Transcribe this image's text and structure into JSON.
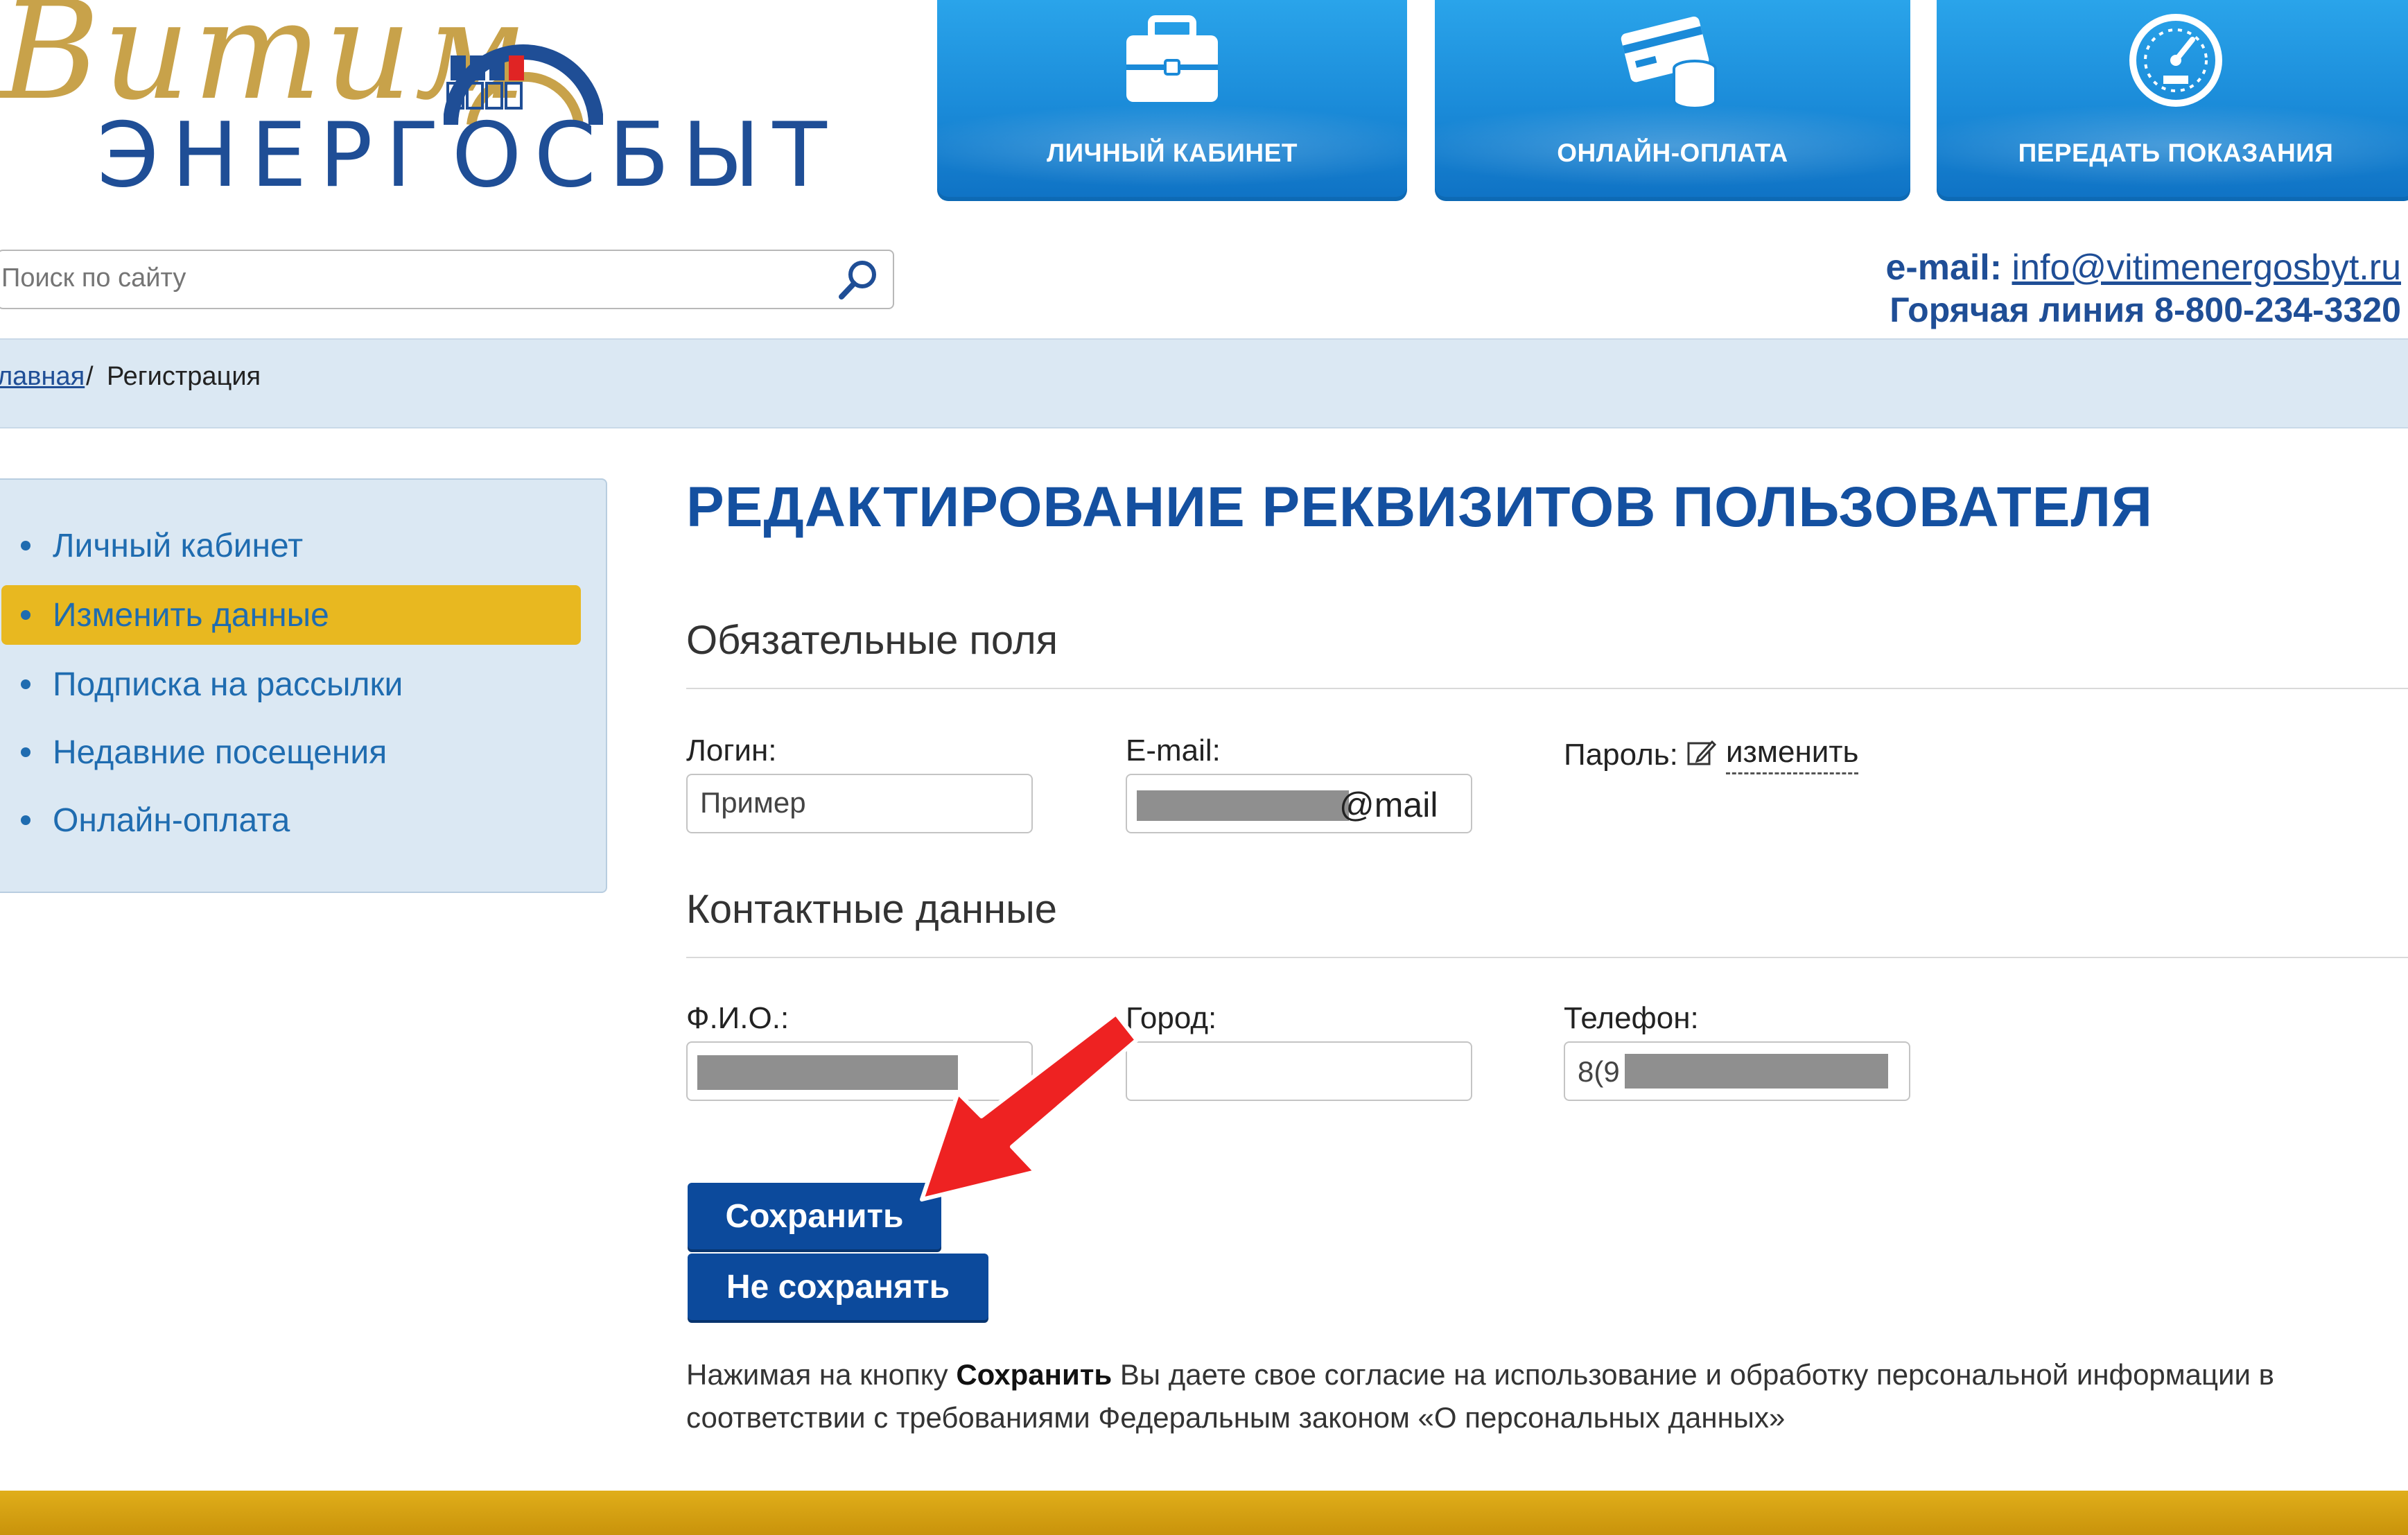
{
  "logo": {
    "script": "Витим",
    "main": "ЭНЕРГОСБЫТ"
  },
  "tiles": [
    {
      "label": "ЛИЧНЫЙ КАБИНЕТ",
      "icon": "briefcase-icon"
    },
    {
      "label": "ОНЛАЙН-ОПЛАТА",
      "icon": "card-coins-icon"
    },
    {
      "label": "ПЕРЕДАТЬ ПОКАЗАНИЯ",
      "icon": "meter-gauge-icon"
    }
  ],
  "search": {
    "placeholder": "Поиск по сайту",
    "icon": "search-icon"
  },
  "contact": {
    "email_label": "e-mail:",
    "email": "info@vitimenergosbyt.ru",
    "hotline": "Горячая линия 8-800-234-3320"
  },
  "breadcrumb": {
    "home": "лавная",
    "sep": "/",
    "current": "Регистрация"
  },
  "sidebar": {
    "items": [
      {
        "label": "Личный кабинет",
        "active": false
      },
      {
        "label": "Изменить данные",
        "active": true
      },
      {
        "label": "Подписка на рассылки",
        "active": false
      },
      {
        "label": "Недавние посещения",
        "active": false
      },
      {
        "label": "Онлайн-оплата",
        "active": false
      }
    ]
  },
  "main": {
    "title": "РЕДАКТИРОВАНИЕ РЕКВИЗИТОВ ПОЛЬЗОВАТЕЛЯ",
    "required_section": "Обязательные поля",
    "login_label": "Логин:",
    "login_value": "Пример",
    "email_label": "E-mail:",
    "email_value_suffix": "@mail",
    "password_label": "Пароль:",
    "password_edit": "изменить",
    "contacts_section": "Контактные данные",
    "fio_label": "Ф.И.О.:",
    "city_label": "Город:",
    "city_value": "",
    "phone_label": "Телефон:",
    "phone_value_prefix": "8(9",
    "save_button": "Сохранить",
    "cancel_button": "Не сохранять",
    "note_prefix": "Нажимая на кнопку",
    "note_bold": "Сохранить",
    "note_line1_rest": "Вы даете свое согласие на использование и обработку персональной информации в",
    "note_line2": "соответствии с требованиями Федеральным законом «О персональных данных»"
  },
  "colors": {
    "brand_blue": "#1f4e96",
    "tile_blue": "#1a8ad8",
    "active_gold": "#e8b820",
    "button_blue": "#0c4a9c",
    "arrow_red": "#ee2222",
    "breadcrumb_bg": "#dbe8f3"
  }
}
